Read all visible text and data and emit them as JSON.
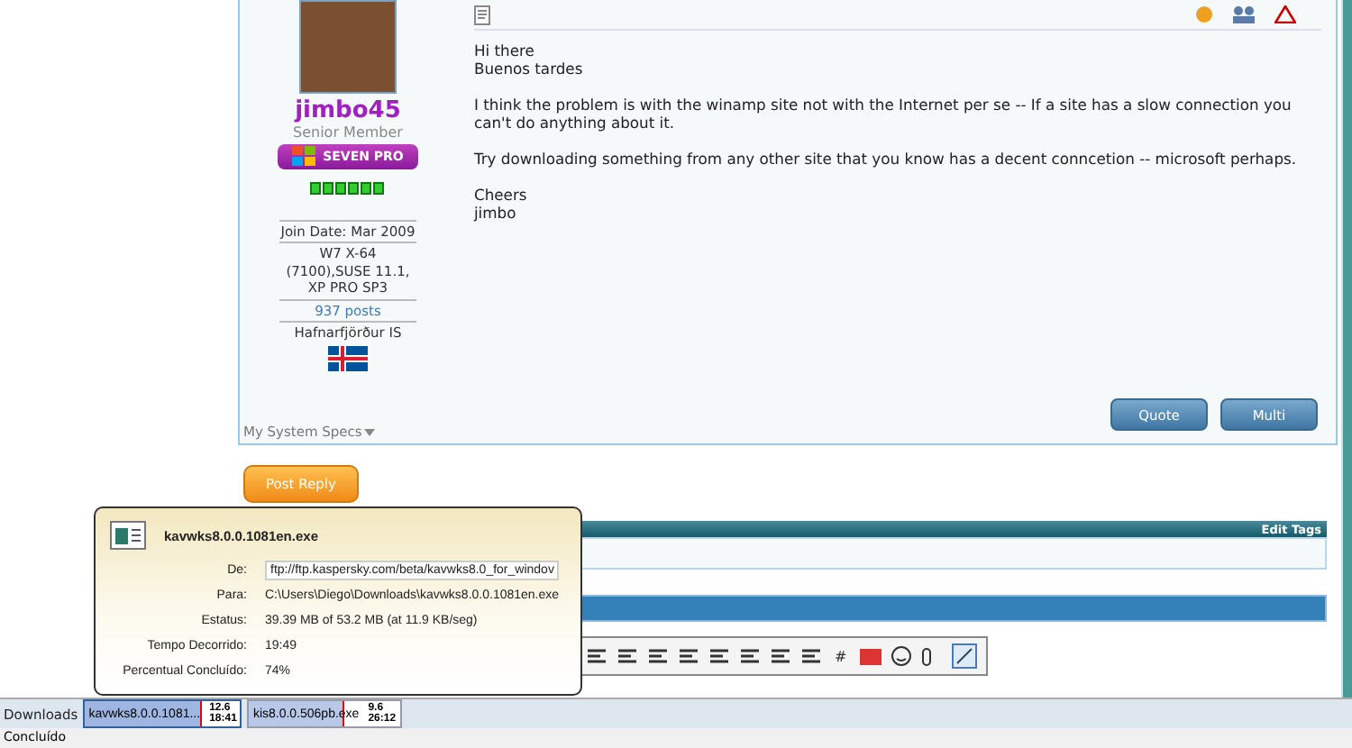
{
  "post": {
    "user": {
      "name": "jimbo45",
      "title": "Senior Member",
      "rank_badge": "SEVEN PRO",
      "join_date": "Join Date: Mar 2009",
      "system": "W7 X-64 (7100),SUSE 11.1, XP PRO SP3",
      "posts": "937 posts",
      "location": "Hafnarfjörður IS"
    },
    "paragraphs": [
      [
        "Hi there",
        "Buenos tardes"
      ],
      [
        "I think the problem is with the winamp site not with the Internet per se -- If a site has a slow connection you can't do anything about it."
      ],
      [
        "Try downloading something from any other site that you know has a decent conncetion -- microsoft perhaps."
      ],
      [
        "Cheers",
        "jimbo"
      ]
    ],
    "specs_link": "My System Specs",
    "buttons": [
      "Quote",
      "Multi"
    ]
  },
  "post_reply": "Post Reply",
  "tags_bar": {
    "link": "Edit Tags"
  },
  "editor": {
    "hash": "#"
  },
  "download_tooltip": {
    "file": "kavwks8.0.0.1081en.exe",
    "fields": [
      {
        "label": "De:",
        "value": "ftp://ftp.kaspersky.com/beta/kavwks8.0_for_windov",
        "kind": "input"
      },
      {
        "label": "Para:",
        "value": "C:\\Users\\Diego\\Downloads\\kavwks8.0.0.1081en.exe",
        "kind": "text"
      },
      {
        "label": "Estatus:",
        "value": "39.39 MB of 53.2 MB (at 11.9 KB/seg)",
        "kind": "text"
      },
      {
        "label": "Tempo Decorrido:",
        "value": "19:49",
        "kind": "text"
      },
      {
        "label": "Percentual Concluído:",
        "value": "74%",
        "kind": "text"
      }
    ]
  },
  "downloads_bar": {
    "label": "Downloads",
    "items": [
      {
        "name": "kavwks8.0.0.1081...",
        "speed": "12.6",
        "time": "18:41",
        "level": 0.74,
        "selected": true
      },
      {
        "name": "kis8.0.0.506pb.exe",
        "speed": "9.6",
        "time": "26:12",
        "level": 0.62,
        "selected": false
      }
    ]
  },
  "status_bar": "Concluído"
}
